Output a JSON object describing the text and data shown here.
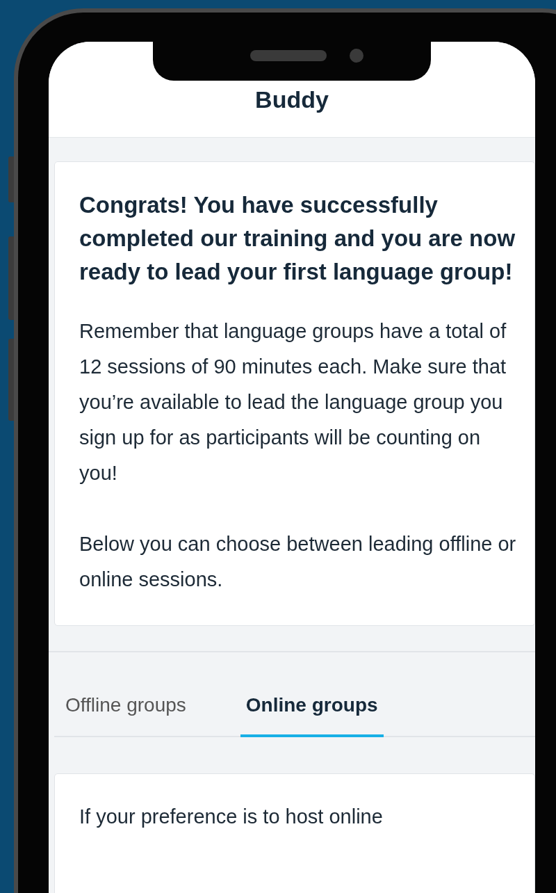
{
  "header": {
    "title": "Buddy"
  },
  "intro_card": {
    "heading": "Congrats! You have successfully completed our training and you are now ready to lead your first language group!",
    "paragraphs": [
      "Remember that language groups have a total of 12 sessions of 90 minutes each. Make sure that you’re available to lead the language group you sign up for as participants will be counting on you!",
      "Below you can choose between leading offline or online sessions."
    ]
  },
  "tabs": [
    {
      "label": "Offline groups",
      "selected": false
    },
    {
      "label": "Online groups",
      "selected": true
    }
  ],
  "info_card": {
    "text": "If your preference is to host online"
  }
}
